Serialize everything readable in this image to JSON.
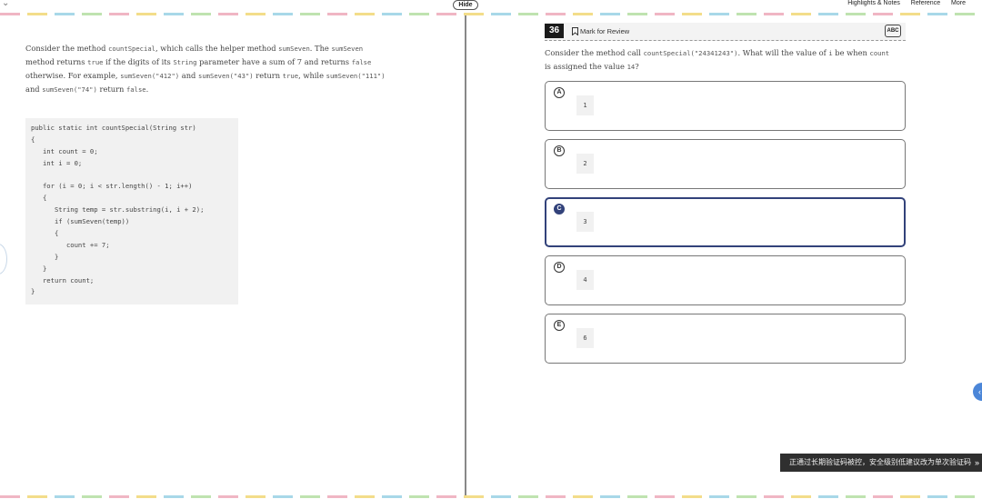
{
  "topbar": {
    "hide_label": "Hide",
    "links": [
      "Highlights & Notes",
      "Reference",
      "More"
    ]
  },
  "prompt": {
    "p1": "Consider the method ",
    "m1": "countSpecial",
    "p2": ", which calls the helper method ",
    "m2": "sumSeven",
    "p3": ". The ",
    "m3": "sumSeven",
    "p4": " method returns ",
    "m4": "true",
    "p5": " if the digits of its ",
    "m5": "String",
    "p6": " parameter have a sum of 7 and returns ",
    "m6": "false",
    "p7": " otherwise. For example, ",
    "m7": "sumSeven(\"412\")",
    "p8": " and ",
    "m8": "sumSeven(\"43\")",
    "p9": " return ",
    "m9": "true",
    "p10": ", while ",
    "m10": "sumSeven(\"111\")",
    "p11": " and ",
    "m11": "sumSeven(\"74\")",
    "p12": " return ",
    "m12": "false",
    "p13": "."
  },
  "code_lines": [
    "public static int countSpecial(String str)",
    "{",
    "   int count = 0;",
    "   int i = 0;",
    "",
    "   for (i = 0; i < str.length() - 1; i++)",
    "   {",
    "      String temp = str.substring(i, i + 2);",
    "      if (sumSeven(temp))",
    "      {",
    "         count += 7;",
    "      }",
    "   }",
    "   return count;",
    "}"
  ],
  "question_header": {
    "number": "36",
    "mark_label": "Mark for Review",
    "abc_label": "ABC"
  },
  "question": {
    "q1": "Consider the method call ",
    "m1": "countSpecial(\"24341243\")",
    "q2": ". What will the value of ",
    "m2": "i",
    "q3": " be when ",
    "m3": "count",
    "q4": " is assigned the value ",
    "m4": "14",
    "q5": "?"
  },
  "options": [
    {
      "letter": "A",
      "value": "1"
    },
    {
      "letter": "B",
      "value": "2"
    },
    {
      "letter": "C",
      "value": "3"
    },
    {
      "letter": "D",
      "value": "4"
    },
    {
      "letter": "E",
      "value": "6"
    }
  ],
  "selected_option": "C",
  "toast": {
    "text": "正通过长期验证码被控，安全级别低建议改为单次验证码",
    "arrow": "»"
  },
  "colors": {
    "selected": "#32427a",
    "float_button": "#4b86d8"
  }
}
